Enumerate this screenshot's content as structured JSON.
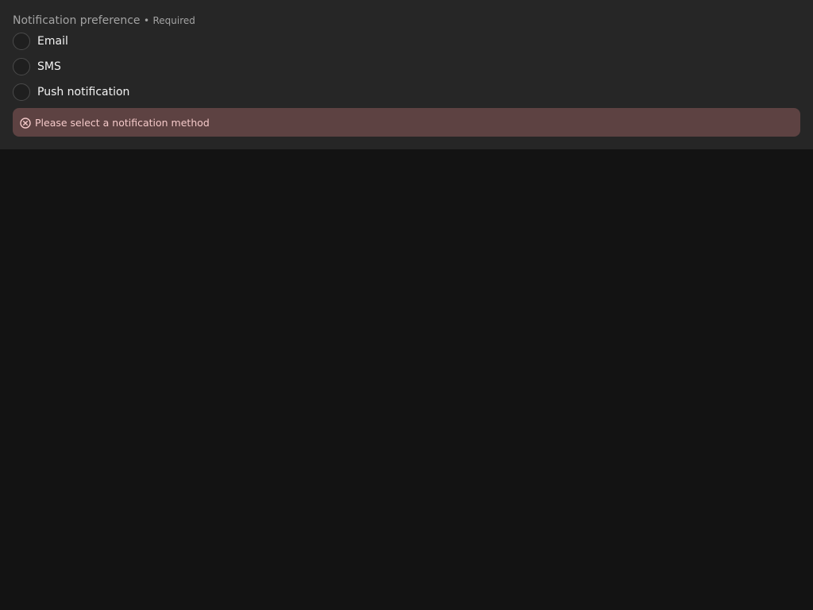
{
  "fieldset": {
    "legend": "Notification preference",
    "separator": "•",
    "required_label": "Required",
    "options": [
      {
        "label": "Email",
        "checked": false
      },
      {
        "label": "SMS",
        "checked": false
      },
      {
        "label": "Push notification",
        "checked": false
      }
    ],
    "error": {
      "icon": "error-circle-x-icon",
      "message": "Please select a notification method",
      "color": "#5d4242"
    }
  }
}
